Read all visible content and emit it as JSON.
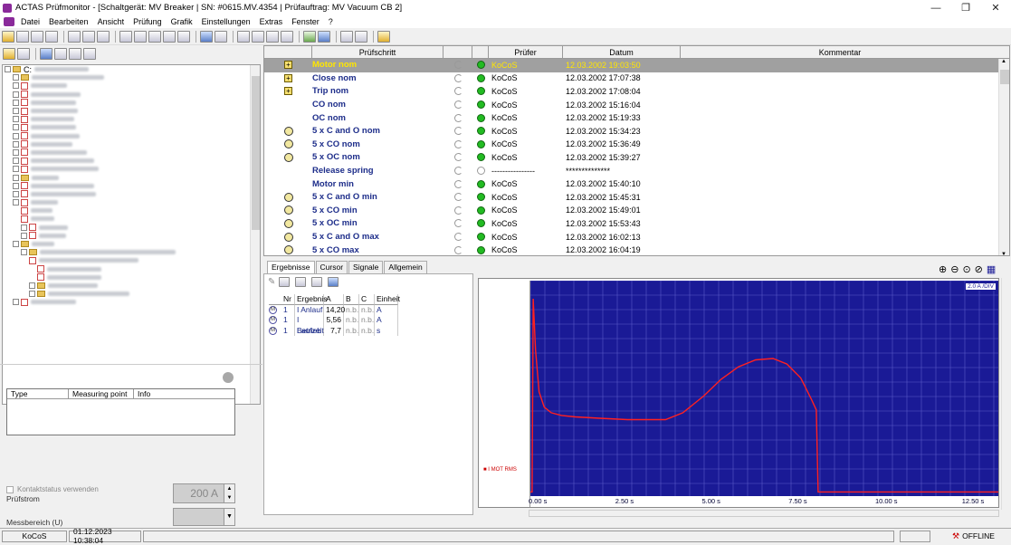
{
  "window": {
    "title": "ACTAS Prüfmonitor - [Schaltgerät: MV Breaker | SN: #0615.MV.4354 | Prüfauftrag: MV Vacuum CB 2]",
    "minimize": "—",
    "maximize": "❐",
    "close": "✕"
  },
  "menu": [
    "Datei",
    "Bearbeiten",
    "Ansicht",
    "Prüfung",
    "Grafik",
    "Einstellungen",
    "Extras",
    "Fenster",
    "?"
  ],
  "tree": {
    "root_label": "C:",
    "row_count": 38
  },
  "info_table": {
    "columns": [
      "Type",
      "Measuring point",
      "Info"
    ]
  },
  "fields": {
    "pruefstrom_label": "Prüfstrom",
    "pruefstrom_value": "200 A",
    "messbereich_label": "Messbereich (U)",
    "kontakt_label": "Kontaktstatus verwenden"
  },
  "grid": {
    "columns": [
      "Prüfschritt",
      "Prüfer",
      "Datum",
      "Kommentar"
    ],
    "rows": [
      {
        "name": "Motor nom",
        "icon": "expand",
        "status": "green",
        "pruefer": "KoCoS",
        "datum": "12.03.2002 19:03:50",
        "selected": true
      },
      {
        "name": "Close nom",
        "icon": "expand",
        "status": "green",
        "pruefer": "KoCoS",
        "datum": "12.03.2002 17:07:38"
      },
      {
        "name": "Trip nom",
        "icon": "expand",
        "status": "green",
        "pruefer": "KoCoS",
        "datum": "12.03.2002 17:08:04"
      },
      {
        "name": "CO nom",
        "icon": "none",
        "status": "green",
        "pruefer": "KoCoS",
        "datum": "12.03.2002 15:16:04"
      },
      {
        "name": "OC nom",
        "icon": "none",
        "status": "green",
        "pruefer": "KoCoS",
        "datum": "12.03.2002 15:19:33"
      },
      {
        "name": "5 x C and O nom",
        "icon": "cycle",
        "status": "green",
        "pruefer": "KoCoS",
        "datum": "12.03.2002 15:34:23"
      },
      {
        "name": "5 x CO nom",
        "icon": "cycle",
        "status": "green",
        "pruefer": "KoCoS",
        "datum": "12.03.2002 15:36:49"
      },
      {
        "name": "5 x OC nom",
        "icon": "cycle",
        "status": "green",
        "pruefer": "KoCoS",
        "datum": "12.03.2002 15:39:27"
      },
      {
        "name": "Release spring",
        "icon": "none",
        "status": "off",
        "pruefer": "----------------",
        "datum": "**************"
      },
      {
        "name": "Motor min",
        "icon": "none",
        "status": "green",
        "pruefer": "KoCoS",
        "datum": "12.03.2002 15:40:10"
      },
      {
        "name": "5 x C and O min",
        "icon": "cycle",
        "status": "green",
        "pruefer": "KoCoS",
        "datum": "12.03.2002 15:45:31"
      },
      {
        "name": "5 x CO min",
        "icon": "cycle",
        "status": "green",
        "pruefer": "KoCoS",
        "datum": "12.03.2002 15:49:01"
      },
      {
        "name": "5 x OC min",
        "icon": "cycle",
        "status": "green",
        "pruefer": "KoCoS",
        "datum": "12.03.2002 15:53:43"
      },
      {
        "name": "5 x C and O max",
        "icon": "cycle",
        "status": "green",
        "pruefer": "KoCoS",
        "datum": "12.03.2002 16:02:13"
      },
      {
        "name": "5 x CO max",
        "icon": "cycle",
        "status": "green",
        "pruefer": "KoCoS",
        "datum": "12.03.2002 16:04:19"
      }
    ]
  },
  "tabs": [
    "Ergebnisse",
    "Cursor",
    "Signale",
    "Allgemein"
  ],
  "results": {
    "columns": [
      "Nr",
      "Ergebnis",
      "A",
      "B",
      "C",
      "Einheit"
    ],
    "rows": [
      {
        "m": "M",
        "nr": "1",
        "ergebnis": "I Anlauf",
        "a": "14,20",
        "b": "n.b.",
        "c": "n.b.",
        "einheit": "A"
      },
      {
        "m": "M",
        "nr": "1",
        "ergebnis": "I Betrieb",
        "a": "5,56",
        "b": "n.b.",
        "c": "n.b.",
        "einheit": "A"
      },
      {
        "m": "M",
        "nr": "1",
        "ergebnis": "Laufzeit",
        "a": "7,7",
        "b": "n.b.",
        "c": "n.b.",
        "einheit": "s"
      }
    ]
  },
  "chart": {
    "div_label": "2.0 A /DIV",
    "legend_series": "I MOT RMS"
  },
  "chart_data": {
    "type": "line",
    "xlabel": "",
    "ylabel": "",
    "x_tick_labels": [
      "0.00 s",
      "2.50 s",
      "5.00 s",
      "7.50 s",
      "10.00 s",
      "12.50 s"
    ],
    "xlim": [
      0,
      13.5
    ],
    "ylim": [
      0,
      15.5
    ],
    "grid": true,
    "series": [
      {
        "name": "I MOT RMS",
        "color": "#ff2020",
        "x": [
          0,
          0.05,
          0.08,
          0.15,
          0.25,
          0.4,
          0.6,
          0.9,
          1.3,
          2.0,
          2.8,
          3.5,
          3.9,
          4.4,
          5.0,
          5.5,
          6.0,
          6.5,
          7.0,
          7.4,
          7.8,
          8.1,
          8.25,
          8.3,
          8.5,
          10,
          12,
          13.5
        ],
        "y": [
          0.3,
          0.3,
          14.2,
          10.5,
          7.5,
          6.4,
          6.0,
          5.8,
          5.7,
          5.6,
          5.5,
          5.5,
          5.5,
          6.0,
          7.2,
          8.4,
          9.3,
          9.8,
          9.9,
          9.5,
          8.5,
          7.0,
          6.2,
          0.3,
          0.3,
          0.3,
          0.3,
          0.3
        ]
      }
    ]
  },
  "status": {
    "user": "KoCoS",
    "datetime": "01.12.2023 10:38:04",
    "offline": "OFFLINE"
  }
}
